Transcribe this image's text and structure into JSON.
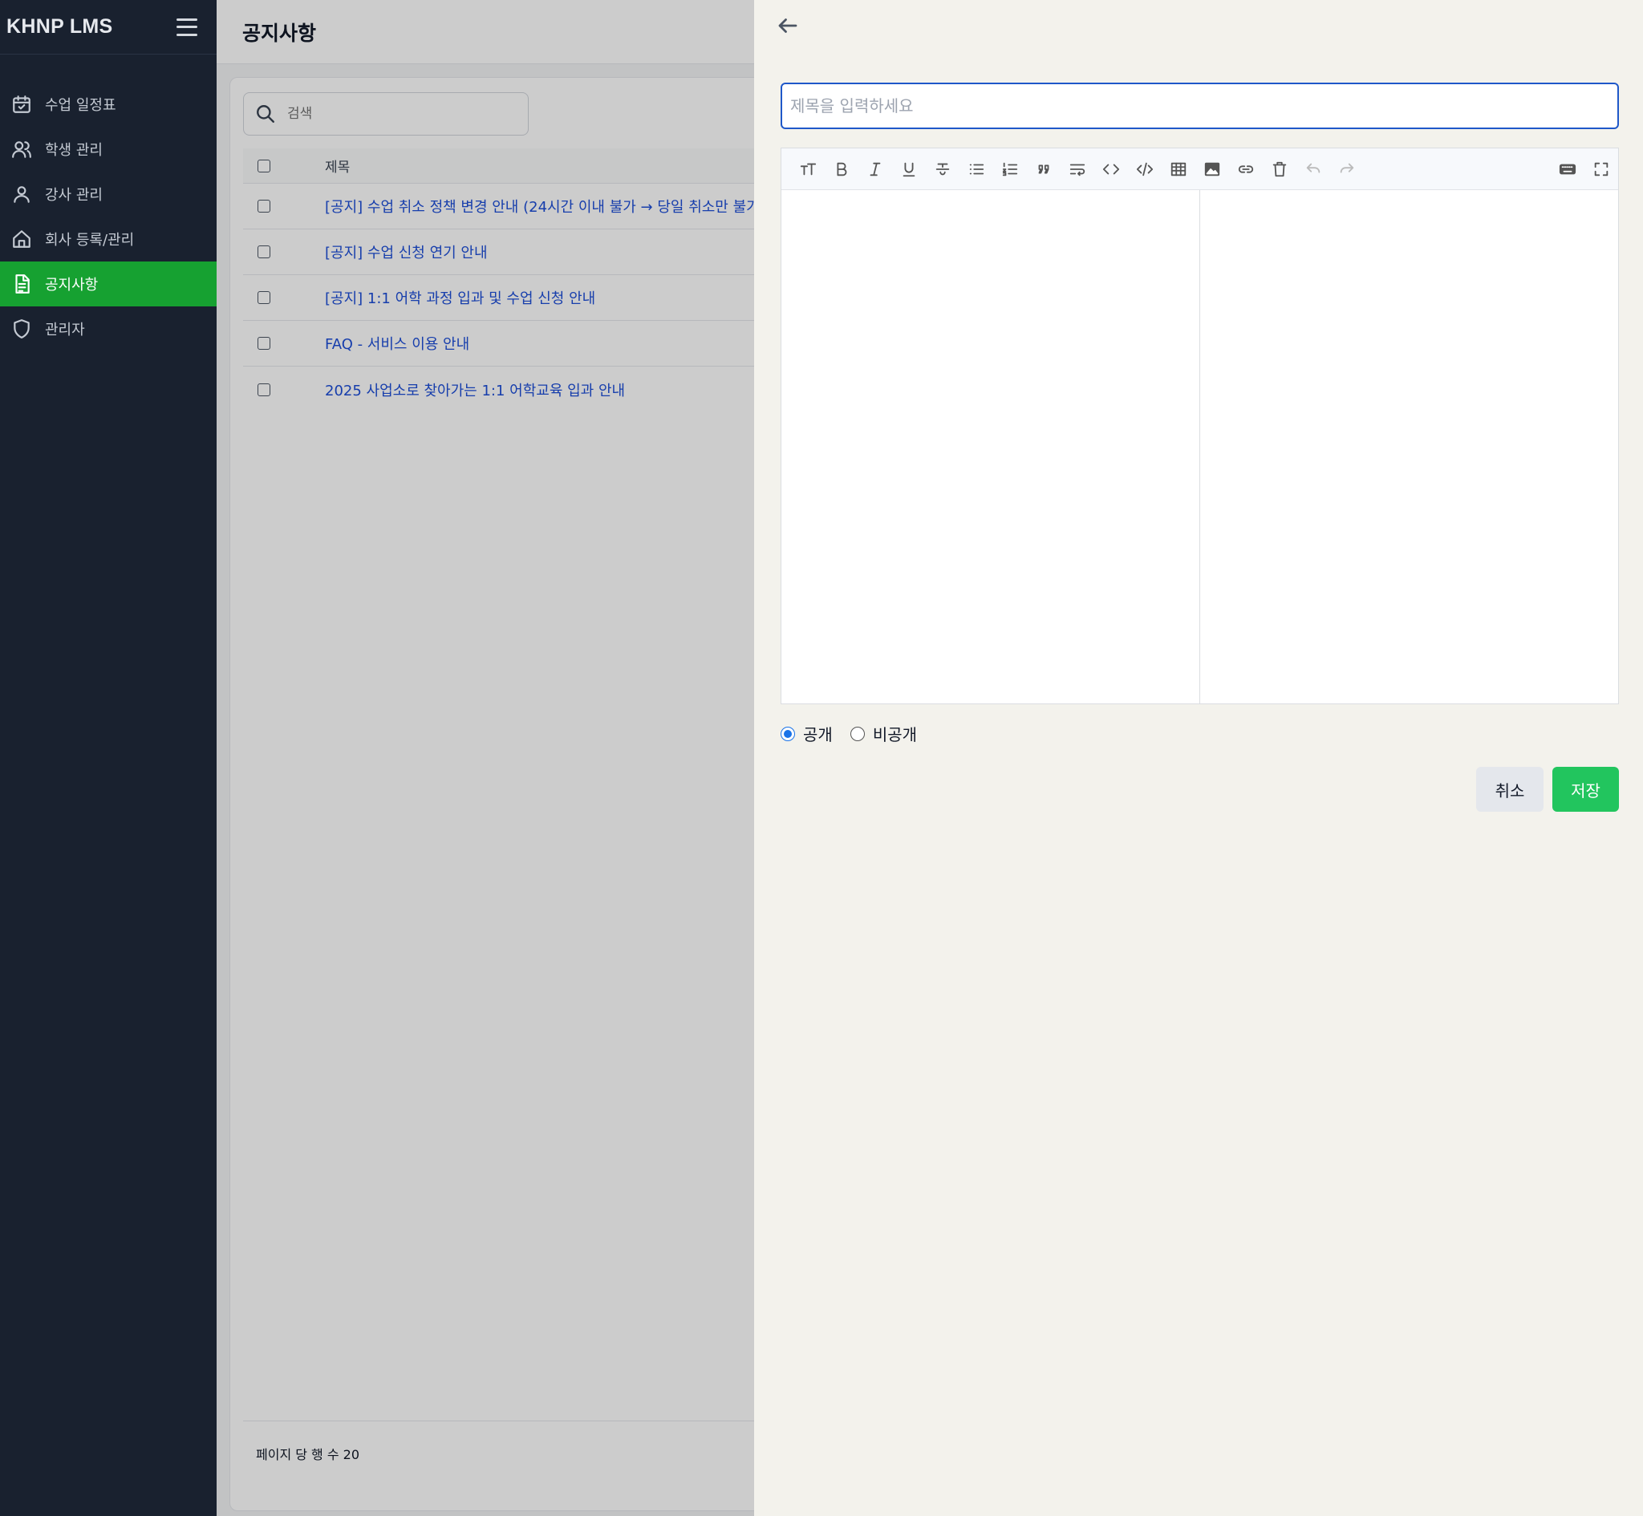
{
  "app": {
    "brand": "KHNP LMS"
  },
  "sidebar": {
    "items": [
      {
        "label": "수업 일정표",
        "icon": "calendar-check-icon",
        "active": false
      },
      {
        "label": "학생 관리",
        "icon": "users-icon",
        "active": false
      },
      {
        "label": "강사 관리",
        "icon": "user-icon",
        "active": false
      },
      {
        "label": "회사 등록/관리",
        "icon": "home-icon",
        "active": false
      },
      {
        "label": "공지사항",
        "icon": "document-icon",
        "active": true
      },
      {
        "label": "관리자",
        "icon": "shield-icon",
        "active": false
      }
    ]
  },
  "main": {
    "title": "공지사항",
    "search": {
      "placeholder": "검색"
    },
    "table": {
      "header": "제목",
      "rows": [
        "[공지] 수업 취소 정책 변경 안내 (24시간 이내 불가 → 당일 취소만 불가",
        "[공지] 수업 신청 연기 안내",
        "[공지] 1:1 어학 과정 입과 및 수업 신청 안내",
        "FAQ - 서비스 이용 안내",
        "2025 사업소로 찾아가는 1:1 어학교육 입과 안내"
      ]
    },
    "footer": {
      "rows_per_page": "페이지 당 행 수 20"
    }
  },
  "drawer": {
    "title_input": {
      "placeholder": "제목을 입력하세요",
      "value": ""
    },
    "toolbar": [
      "heading-icon",
      "bold-icon",
      "italic-icon",
      "underline-icon",
      "strikethrough-icon",
      "bullet-list-icon",
      "ordered-list-icon",
      "quote-icon",
      "wrap-icon",
      "code-icon",
      "code-block-icon",
      "table-icon",
      "image-icon",
      "link-icon",
      "trash-icon",
      "undo-icon",
      "redo-icon",
      "keyboard-icon",
      "fullscreen-icon"
    ],
    "visibility": {
      "public_label": "공개",
      "private_label": "비공개",
      "selected": "공개"
    },
    "cancel_label": "취소",
    "save_label": "저장"
  },
  "colors": {
    "sidebar_bg": "#19212f",
    "active_nav": "#16a131",
    "link": "#1d4ed8",
    "save_button": "#22c55e",
    "input_focus": "#1f58c9"
  }
}
